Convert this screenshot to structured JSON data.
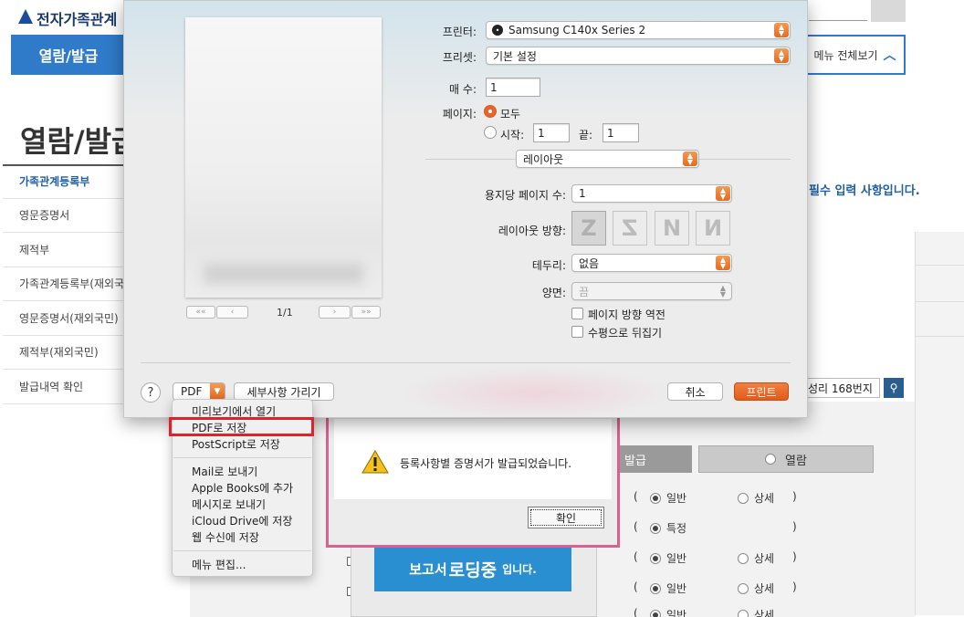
{
  "website": {
    "logo_text": "전자가족관계",
    "nav_active": "열람/발급",
    "menu_all": "메뉴 전체보기",
    "page_title": "열람/발급",
    "sidebar": [
      {
        "label": "가족관계등록부",
        "active": true
      },
      {
        "label": "영문증명서",
        "active": false
      },
      {
        "label": "제적부",
        "active": false
      },
      {
        "label": "가족관계등록부(재외국민)",
        "active": false
      },
      {
        "label": "영문증명서(재외국민)",
        "active": false
      },
      {
        "label": "제적부(재외국민)",
        "active": false
      },
      {
        "label": "발급내역 확인",
        "active": false
      }
    ],
    "notice": "필수 입력 사항입니다.",
    "address_value": "성리 168번지",
    "tab_issue": "발급",
    "tab_view": "열람",
    "options": [
      {
        "a": "일반",
        "b": "상세"
      },
      {
        "a": "특정",
        "b": ""
      },
      {
        "a": "일반",
        "b": "상세"
      },
      {
        "a": "일반",
        "b": "상세"
      },
      {
        "a": "일반",
        "b": "상세"
      }
    ],
    "loading": {
      "pre": "보고서",
      "big": "로딩중",
      "post": "입니다."
    }
  },
  "alert": {
    "message": "등록사항별 증명서가 발급되었습니다.",
    "ok_label": "확인"
  },
  "print_dialog": {
    "printer_label": "프린터:",
    "printer_value": "Samsung C140x Series 2",
    "preset_label": "프리셋:",
    "preset_value": "기본 설정",
    "copies_label": "매 수:",
    "copies_value": "1",
    "pages_label": "페이지:",
    "pages_all": "모두",
    "pages_from_label": "시작:",
    "pages_from_value": "1",
    "pages_to_label": "끝:",
    "pages_to_value": "1",
    "section_value": "레이아웃",
    "pages_per_sheet_label": "용지당 페이지 수:",
    "pages_per_sheet_value": "1",
    "layout_direction_label": "레이아웃 방향:",
    "border_label": "테두리:",
    "border_value": "없음",
    "two_sided_label": "양면:",
    "two_sided_value": "끔",
    "reverse_orientation": "페이지 방향 역전",
    "flip_horizontal": "수평으로 뒤집기",
    "page_indicator": "1/1",
    "help_label": "?",
    "pdf_label": "PDF",
    "hide_details": "세부사항 가리기",
    "cancel": "취소",
    "print": "프린트",
    "layout_directions": [
      "Z",
      "Z",
      "N",
      "N"
    ]
  },
  "pdf_menu": {
    "items_group1": [
      "미리보기에서 열기",
      "PDF로 저장",
      "PostScript로 저장"
    ],
    "items_group2": [
      "Mail로 보내기",
      "Apple Books에 추가",
      "메시지로 보내기",
      "iCloud Drive에 저장",
      "웹 수신에 저장"
    ],
    "items_group3": [
      "메뉴 편집..."
    ],
    "highlighted": "PDF로 저장"
  },
  "colors": {
    "accent_orange": "#e5652a",
    "site_blue": "#2f7ac9",
    "highlight_red": "#e0202a",
    "alert_border": "#d9608f"
  }
}
